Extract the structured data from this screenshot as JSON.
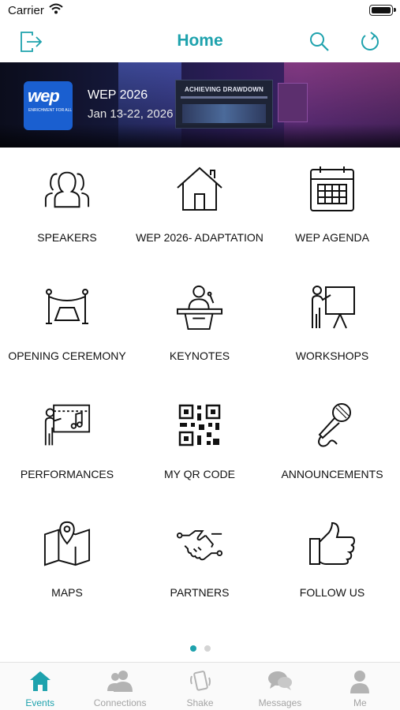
{
  "status_bar": {
    "carrier": "Carrier"
  },
  "nav": {
    "title": "Home"
  },
  "banner": {
    "event_name": "WEP 2026",
    "dates": "Jan 13-22, 2026",
    "logo_text": "wep",
    "logo_tagline": "ENRICHMENT FOR ALL",
    "screen_title": "ACHIEVING DRAWDOWN"
  },
  "tiles": [
    {
      "label": "SPEAKERS",
      "icon": "speakers-icon"
    },
    {
      "label": "WEP 2026- ADAPTATION",
      "icon": "home-icon"
    },
    {
      "label": "WEP AGENDA",
      "icon": "calendar-icon"
    },
    {
      "label": "OPENING CEREMONY",
      "icon": "ribbon-cutting-icon"
    },
    {
      "label": "KEYNOTES",
      "icon": "podium-icon"
    },
    {
      "label": "WORKSHOPS",
      "icon": "presentation-icon"
    },
    {
      "label": "PERFORMANCES",
      "icon": "music-board-icon"
    },
    {
      "label": "MY QR CODE",
      "icon": "qr-code-icon"
    },
    {
      "label": "ANNOUNCEMENTS",
      "icon": "microphone-icon"
    },
    {
      "label": "MAPS",
      "icon": "map-icon"
    },
    {
      "label": "PARTNERS",
      "icon": "handshake-icon"
    },
    {
      "label": "FOLLOW US",
      "icon": "thumbs-up-icon"
    }
  ],
  "pager": {
    "pages": 2,
    "current": 1
  },
  "tab_bar": {
    "items": [
      {
        "label": "Events",
        "icon": "events-home-icon",
        "active": true
      },
      {
        "label": "Connections",
        "icon": "connections-icon",
        "active": false
      },
      {
        "label": "Shake",
        "icon": "shake-phone-icon",
        "active": false
      },
      {
        "label": "Messages",
        "icon": "messages-icon",
        "active": false
      },
      {
        "label": "Me",
        "icon": "profile-icon",
        "active": false
      }
    ]
  },
  "colors": {
    "accent": "#1ea2ad",
    "inactive": "#a4a4a4",
    "logo_blue": "#1a5fd0"
  }
}
